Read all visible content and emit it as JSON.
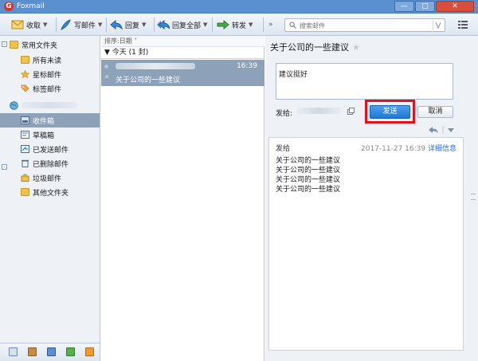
{
  "app": {
    "title": "Foxmail",
    "logo_letter": "G"
  },
  "toolbar": {
    "receive": "收取",
    "compose": "写邮件",
    "reply": "回复",
    "reply_all": "回复全部",
    "forward": "转发",
    "more": "»",
    "search_placeholder": "搜索邮件"
  },
  "sidebar": {
    "common_folders": "常用文件夹",
    "items_common": [
      {
        "label": "所有未读"
      },
      {
        "label": "星标邮件"
      },
      {
        "label": "标签邮件"
      }
    ],
    "account_items": [
      {
        "label": "收件箱",
        "selected": true
      },
      {
        "label": "草稿箱"
      },
      {
        "label": "已发送邮件"
      },
      {
        "label": "已删除邮件"
      },
      {
        "label": "垃圾邮件"
      },
      {
        "label": "其他文件夹"
      }
    ]
  },
  "list": {
    "sort_label": "排序:日期",
    "group_label": "今天 (1 封)",
    "messages": [
      {
        "time": "16:39",
        "subject": "关于公司的一些建议"
      }
    ]
  },
  "reader": {
    "subject": "关于公司的一些建议",
    "reply_text": "建议挺好",
    "send_to_label": "发给:",
    "send_button": "发送",
    "cancel_button": "取消",
    "from_label": "发给",
    "date": "2017-11-27 16:39",
    "detail_link": "详细信息",
    "body_lines": [
      "关于公司的一些建议",
      "关于公司的一些建议",
      "关于公司的一些建议",
      "关于公司的一些建议"
    ]
  },
  "colors": {
    "titlebar": "#5a8fd0",
    "selection": "#8da1b9",
    "send_button": "#1f79d6",
    "highlight_box": "#e0151b"
  }
}
